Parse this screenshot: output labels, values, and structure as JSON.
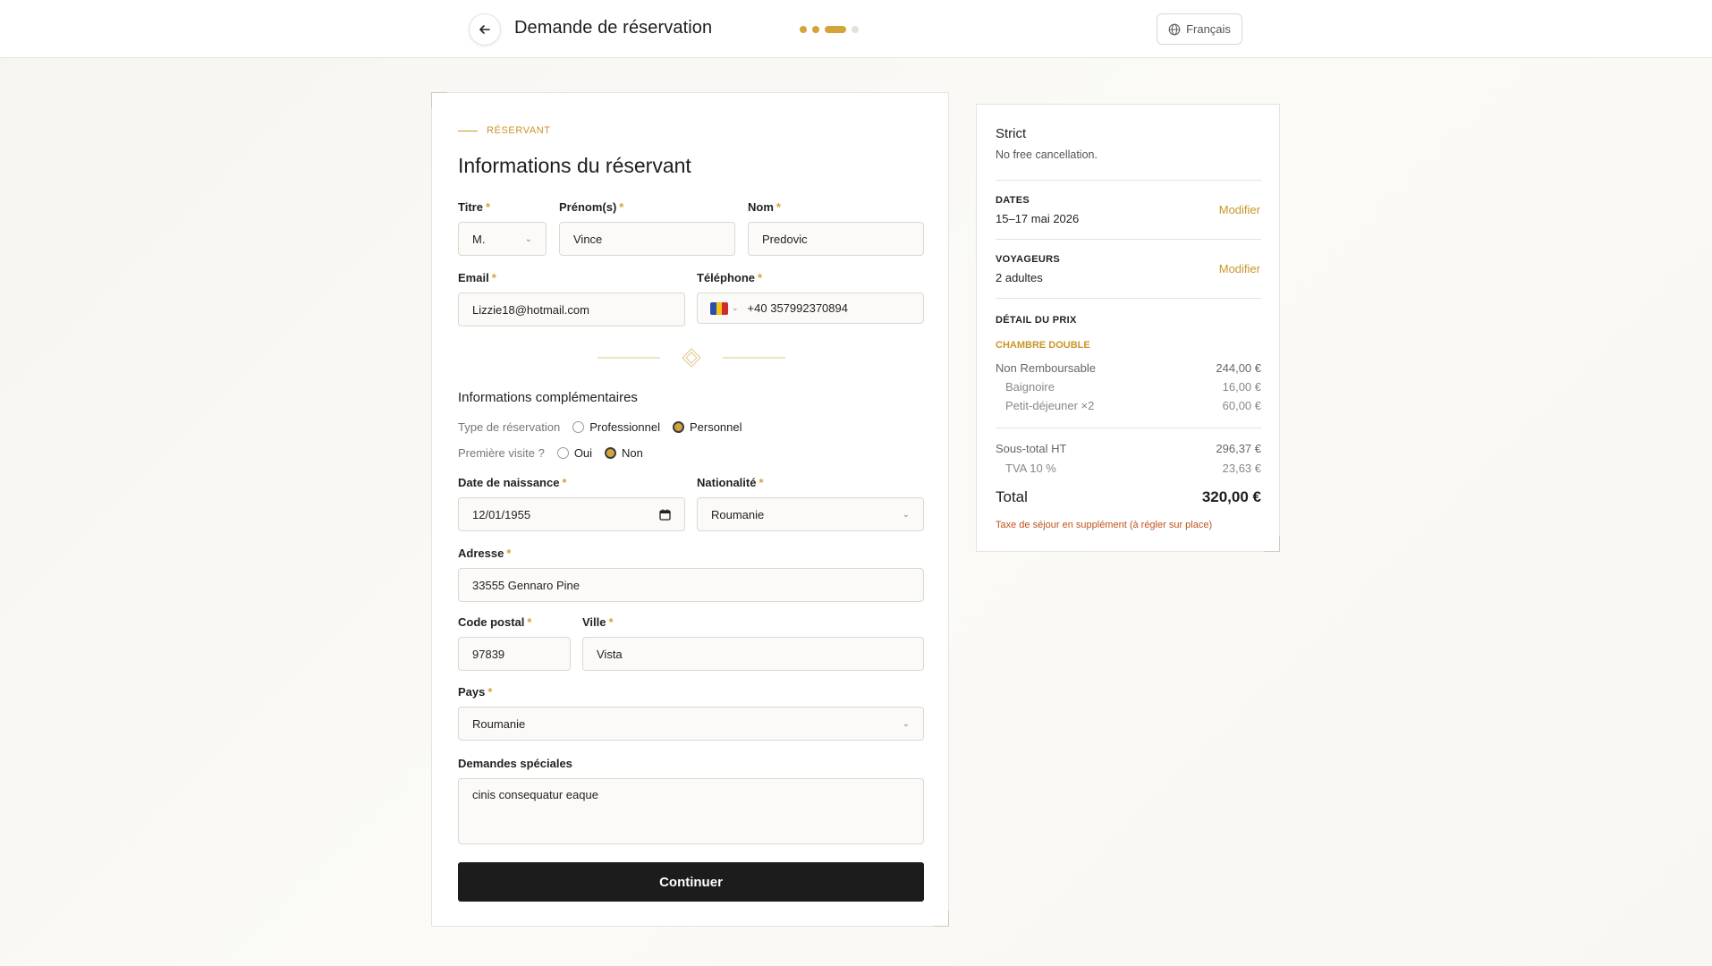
{
  "header": {
    "title": "Demande de réservation",
    "language": "Français",
    "steps_total": 4,
    "steps_current": 3
  },
  "form": {
    "eyebrow": "RÉSERVANT",
    "title": "Informations du réservant",
    "fields": {
      "titre": {
        "label": "Titre",
        "value": "M."
      },
      "prenom": {
        "label": "Prénom(s)",
        "value": "Vince"
      },
      "nom": {
        "label": "Nom",
        "value": "Predovic"
      },
      "email": {
        "label": "Email",
        "value": "Lizzie18@hotmail.com"
      },
      "telephone": {
        "label": "Téléphone",
        "value": "+40 357992370894"
      },
      "naissance": {
        "label": "Date de naissance",
        "value": "12/01/1955"
      },
      "nationalite": {
        "label": "Nationalité",
        "value": "Roumanie"
      },
      "adresse": {
        "label": "Adresse",
        "value": "33555 Gennaro Pine"
      },
      "code_postal": {
        "label": "Code postal",
        "value": "97839"
      },
      "ville": {
        "label": "Ville",
        "value": "Vista"
      },
      "pays": {
        "label": "Pays",
        "value": "Roumanie"
      },
      "demandes": {
        "label": "Demandes spéciales",
        "value": "cinis consequatur eaque"
      }
    },
    "required_mark": "*",
    "complementary": {
      "title": "Informations complémentaires",
      "type_label": "Type de réservation",
      "type_options": [
        "Professionnel",
        "Personnel"
      ],
      "type_selected": "Personnel",
      "visit_label": "Première visite ?",
      "visit_options": [
        "Oui",
        "Non"
      ],
      "visit_selected": "Non"
    },
    "submit": "Continuer"
  },
  "summary": {
    "policy_title": "Strict",
    "policy_desc": "No free cancellation.",
    "dates_caption": "DATES",
    "dates_value": "15–17 mai 2026",
    "travelers_caption": "VOYAGEURS",
    "travelers_value": "2 adultes",
    "modify": "Modifier",
    "price_caption": "DÉTAIL DU PRIX",
    "room": "CHAMBRE DOUBLE",
    "lines": [
      {
        "label": "Non Remboursable",
        "amount": "244,00 €"
      },
      {
        "label": "Baignoire",
        "amount": "16,00 €"
      },
      {
        "label": "Petit-déjeuner ×2",
        "amount": "60,00 €"
      }
    ],
    "subtotal_label": "Sous-total HT",
    "subtotal_amount": "296,37 €",
    "tax_label": "TVA 10 %",
    "tax_amount": "23,63 €",
    "total_label": "Total",
    "total_amount": "320,00 €",
    "note": "Taxe de séjour en supplément (à régler sur place)"
  },
  "colors": {
    "accent": "#d2a439",
    "note": "#c0521b",
    "button": "#1c1c1c"
  },
  "icons": [
    "back-arrow-icon",
    "globe-icon",
    "chevron-down-icon",
    "calendar-icon",
    "romania-flag-icon"
  ]
}
